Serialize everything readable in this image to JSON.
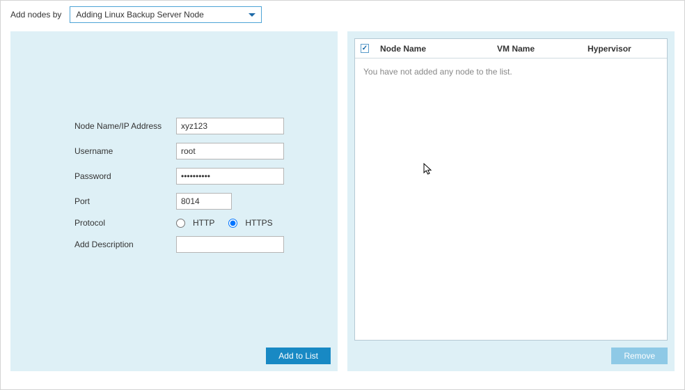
{
  "topLabel": "Add nodes by",
  "combo": {
    "selected": "Adding Linux Backup Server Node"
  },
  "form": {
    "labels": {
      "nodeName": "Node Name/IP Address",
      "username": "Username",
      "password": "Password",
      "port": "Port",
      "protocol": "Protocol",
      "desc": "Add Description"
    },
    "values": {
      "nodeName": "xyz123",
      "username": "root",
      "password": "••••••••••",
      "port": "8014",
      "desc": ""
    },
    "protocolOptions": {
      "http": "HTTP",
      "https": "HTTPS"
    },
    "protocolSelected": "https"
  },
  "buttons": {
    "addToList": "Add to List",
    "remove": "Remove"
  },
  "grid": {
    "columns": {
      "nodeName": "Node Name",
      "vmName": "VM Name",
      "hypervisor": "Hypervisor"
    },
    "emptyText": "You have not added any node to the list."
  }
}
